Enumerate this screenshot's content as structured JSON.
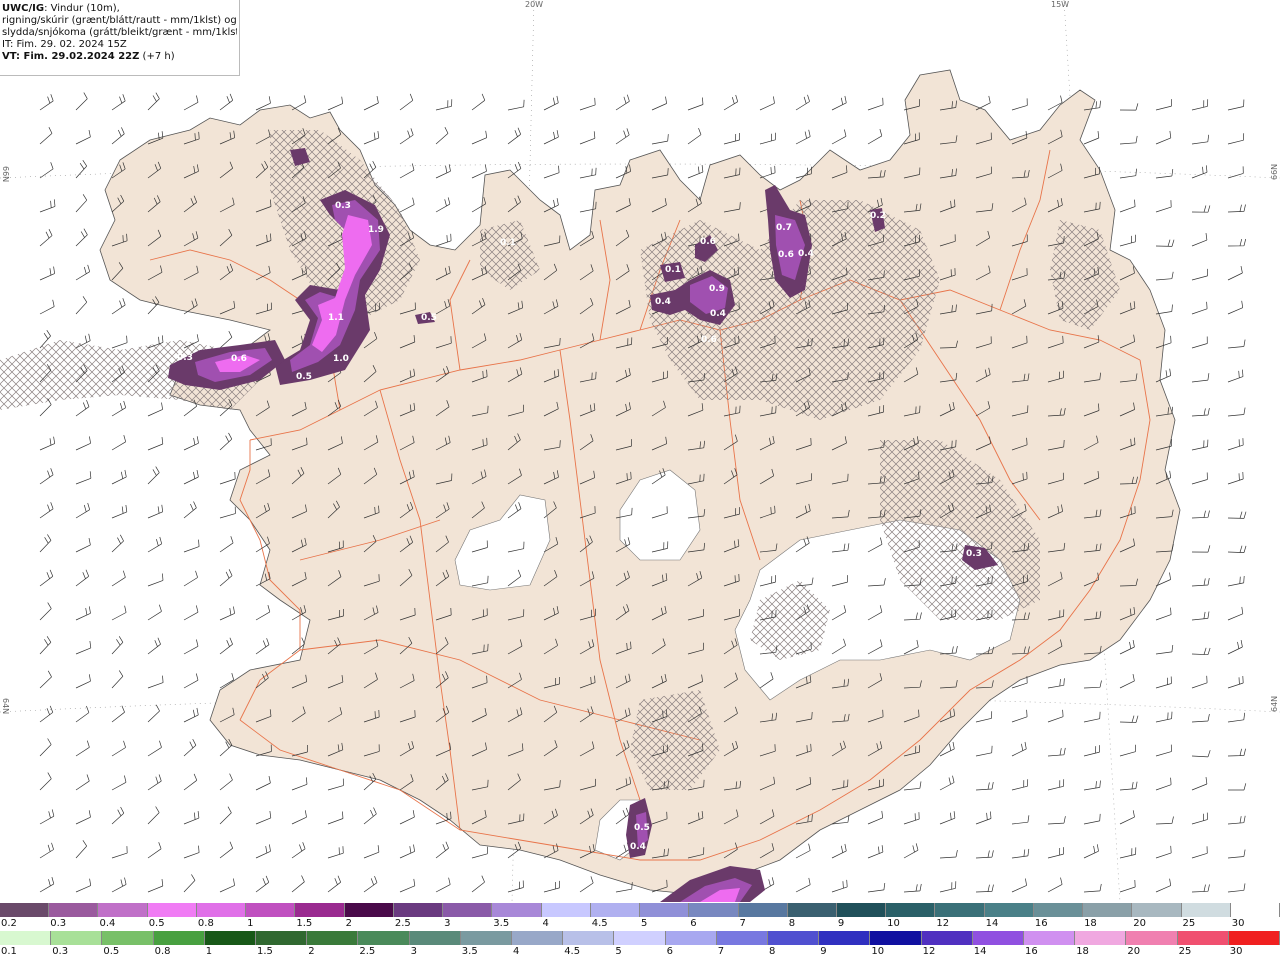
{
  "header": {
    "model": "UWC/IG",
    "line1_rest": ": Vindur (10m),",
    "line2": "rigning/skúrir (grænt/blátt/rautt - mm/1klst) og",
    "line3": "slydda/snjókoma (grátt/bleikt/grænt - mm/1klst)",
    "init_time": "IT: Fim. 29. 02. 2024 15Z",
    "valid_prefix": "VT: Fim. 29.02.2024 22Z",
    "valid_suffix": " (+7 h)"
  },
  "coords": {
    "top_20w": "20W",
    "top_15w": "15W",
    "left_66n": "66N",
    "right_66n": "66N",
    "left_64n": "64N",
    "right_64n": "64N"
  },
  "colors": {
    "land": "#f2e4d6",
    "sea": "#ffffff",
    "road": "#e8744a",
    "hatch": "#8a8080",
    "precip_dark": "#6a3a6a",
    "precip_mid": "#a050b0",
    "precip_bright": "#ee6cf0"
  },
  "precip_labels": [
    {
      "text": "0.3"
    },
    {
      "text": "1.9"
    },
    {
      "text": "1.1"
    },
    {
      "text": "1.0"
    },
    {
      "text": "0.5"
    },
    {
      "text": "0.6"
    },
    {
      "text": "0.3"
    },
    {
      "text": "0.5"
    },
    {
      "text": "0.1"
    },
    {
      "text": "0.1"
    },
    {
      "text": "0.6"
    },
    {
      "text": "0.4"
    },
    {
      "text": "0.9"
    },
    {
      "text": "0.4"
    },
    {
      "text": "0.6"
    },
    {
      "text": "0.7"
    },
    {
      "text": "0.6"
    },
    {
      "text": "0.4"
    },
    {
      "text": "0.2"
    },
    {
      "text": "0.3"
    },
    {
      "text": "0.5"
    },
    {
      "text": "0.4"
    }
  ],
  "legend_snow": {
    "labels": [
      "0.2",
      "0.3",
      "0.4",
      "0.5",
      "0.8",
      "1",
      "1.5",
      "2",
      "2.5",
      "3",
      "3.5",
      "4",
      "4.5",
      "5",
      "6",
      "7",
      "8",
      "9",
      "10",
      "12",
      "14",
      "16",
      "18",
      "20",
      "25",
      "30"
    ],
    "colors": [
      "#6a4a6a",
      "#9a5a9e",
      "#c070c8",
      "#f07cf4",
      "#e070e8",
      "#c050c0",
      "#9a2a90",
      "#4a0a4a",
      "#6a3a80",
      "#8a5aa8",
      "#a888d8",
      "#c8c8ff",
      "#b0b0f0",
      "#9090d8",
      "#7888c0",
      "#5878a0",
      "#3a6070",
      "#20505a",
      "#2a6068",
      "#3a7078",
      "#4a8088",
      "#6a9098",
      "#8aa0a8",
      "#a8b8c0",
      "#d0dce0",
      "#ffffff"
    ]
  },
  "legend_rain": {
    "labels": [
      "0.1",
      "0.3",
      "0.5",
      "0.8",
      "1",
      "1.5",
      "2",
      "2.5",
      "3",
      "3.5",
      "4",
      "4.5",
      "5",
      "6",
      "7",
      "8",
      "9",
      "10",
      "12",
      "14",
      "16",
      "18",
      "20",
      "25",
      "30"
    ],
    "colors": [
      "#d8f8d0",
      "#a8e098",
      "#78c068",
      "#48a040",
      "#185818",
      "#306830",
      "#3a7a3a",
      "#4a8a5a",
      "#5a8a7a",
      "#7a9aa0",
      "#98a8c8",
      "#b8c0e8",
      "#d0d0ff",
      "#a8a8f0",
      "#7878e0",
      "#5050d0",
      "#3030c0",
      "#1010a0",
      "#5030c0",
      "#9050e0",
      "#d090f0",
      "#f0a8e0",
      "#f080b0",
      "#f05070",
      "#f02020"
    ]
  }
}
